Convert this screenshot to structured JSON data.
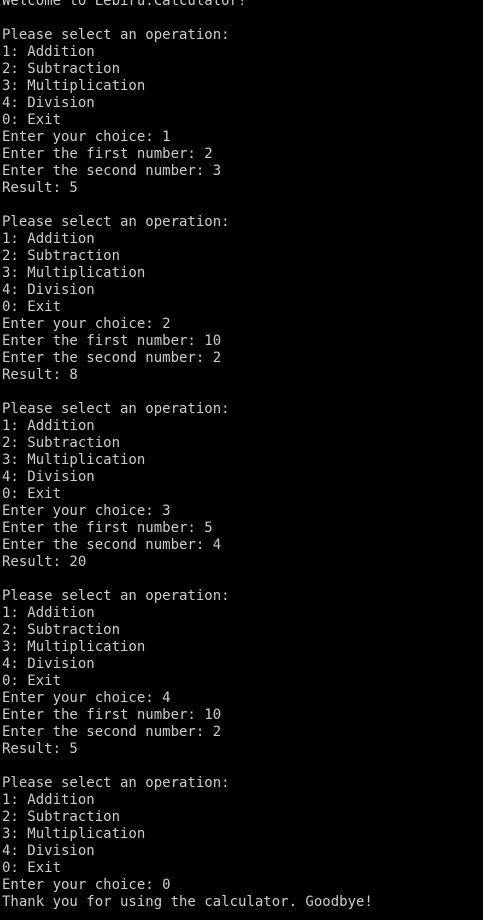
{
  "terminal": {
    "lines": [
      "Welcome to Lebiru.Calculator!",
      "",
      "Please select an operation:",
      "1: Addition",
      "2: Subtraction",
      "3: Multiplication",
      "4: Division",
      "0: Exit",
      "Enter your choice: 1",
      "Enter the first number: 2",
      "Enter the second number: 3",
      "Result: 5",
      "",
      "Please select an operation:",
      "1: Addition",
      "2: Subtraction",
      "3: Multiplication",
      "4: Division",
      "0: Exit",
      "Enter your choice: 2",
      "Enter the first number: 10",
      "Enter the second number: 2",
      "Result: 8",
      "",
      "Please select an operation:",
      "1: Addition",
      "2: Subtraction",
      "3: Multiplication",
      "4: Division",
      "0: Exit",
      "Enter your choice: 3",
      "Enter the first number: 5",
      "Enter the second number: 4",
      "Result: 20",
      "",
      "Please select an operation:",
      "1: Addition",
      "2: Subtraction",
      "3: Multiplication",
      "4: Division",
      "0: Exit",
      "Enter your choice: 4",
      "Enter the first number: 10",
      "Enter the second number: 2",
      "Result: 5",
      "",
      "Please select an operation:",
      "1: Addition",
      "2: Subtraction",
      "3: Multiplication",
      "4: Division",
      "0: Exit",
      "Enter your choice: 0",
      "Thank you for using the calculator. Goodbye!"
    ],
    "colors": {
      "background": "#000000",
      "text": "#cccccc"
    }
  }
}
